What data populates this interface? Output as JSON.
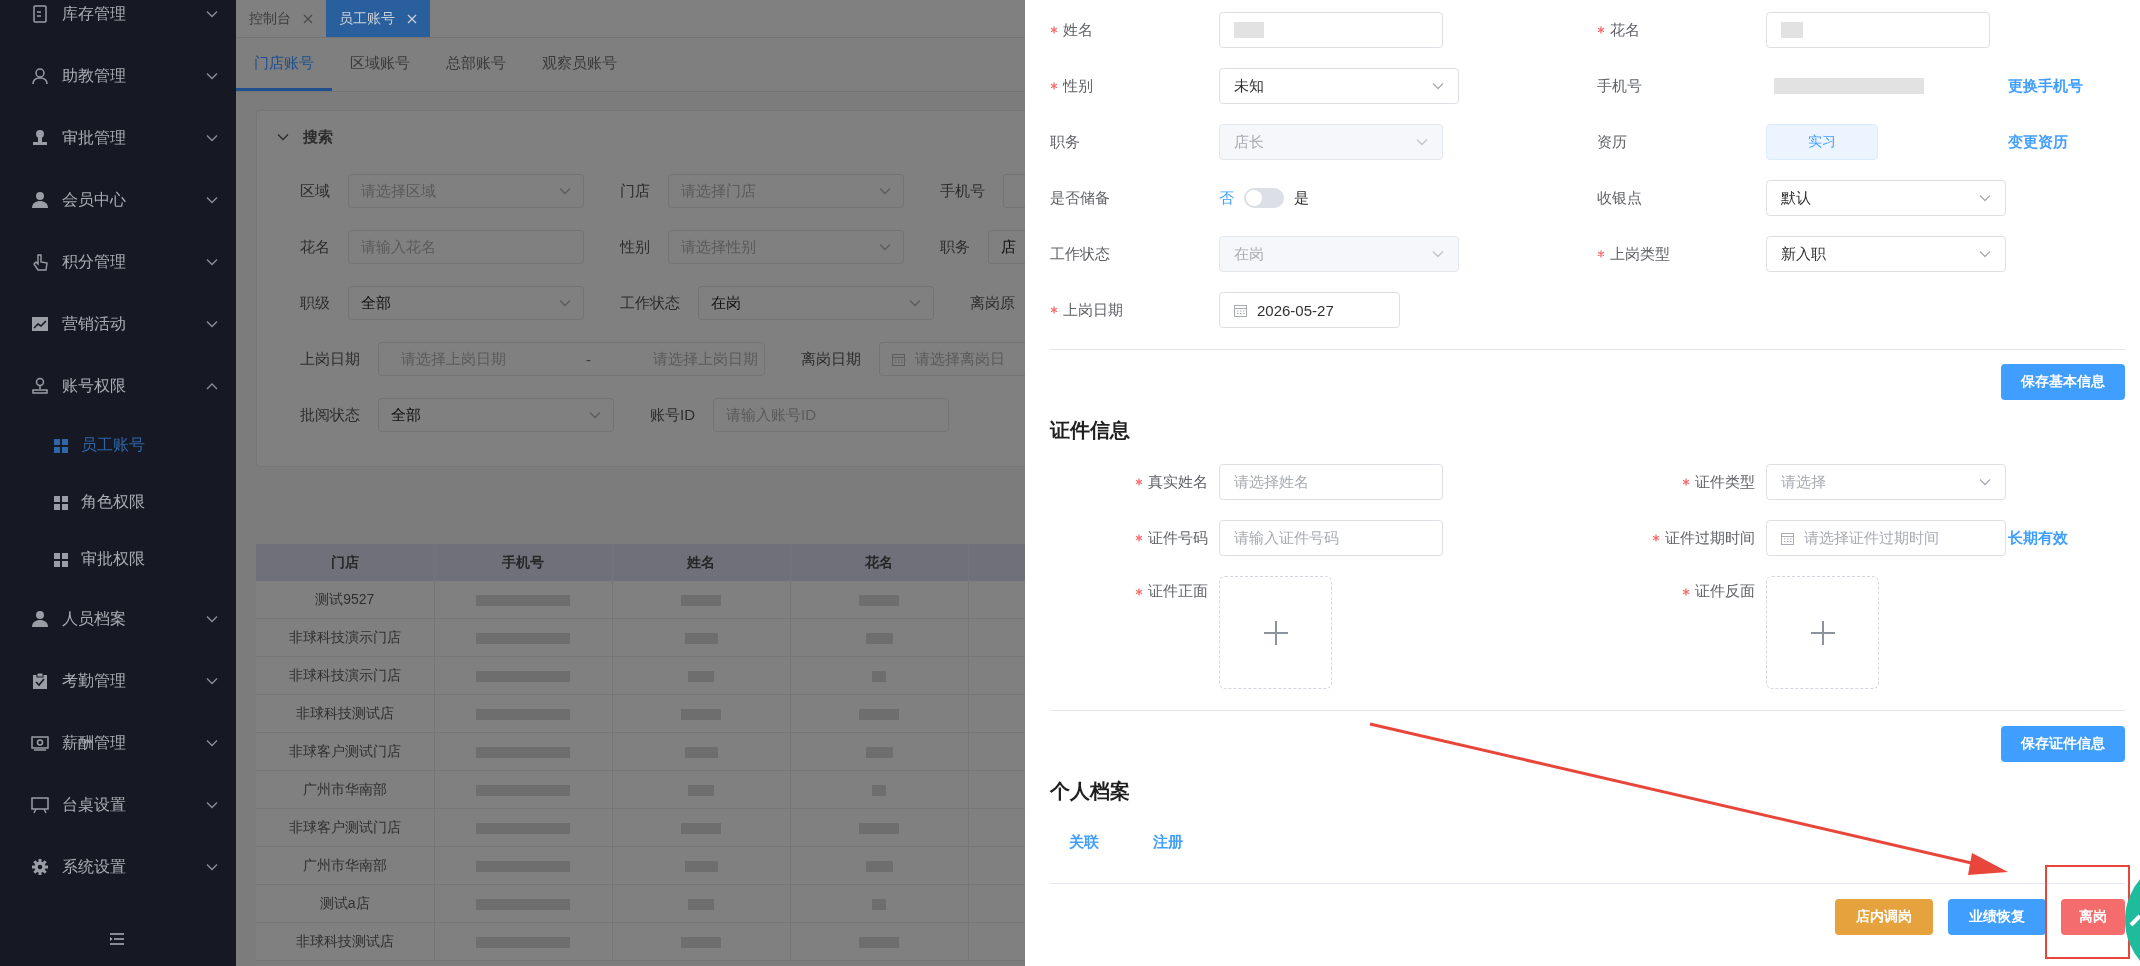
{
  "sidebar": {
    "items": [
      {
        "label": "库存管理",
        "expanded": false
      },
      {
        "label": "助教管理",
        "expanded": false
      },
      {
        "label": "审批管理",
        "expanded": false
      },
      {
        "label": "会员中心",
        "expanded": false
      },
      {
        "label": "积分管理",
        "expanded": false
      },
      {
        "label": "营销活动",
        "expanded": false
      },
      {
        "label": "账号权限",
        "expanded": true,
        "children": [
          {
            "label": "员工账号",
            "selected": true
          },
          {
            "label": "角色权限",
            "selected": false
          },
          {
            "label": "审批权限",
            "selected": false
          }
        ]
      },
      {
        "label": "人员档案",
        "expanded": false
      },
      {
        "label": "考勤管理",
        "expanded": false
      },
      {
        "label": "薪酬管理",
        "expanded": false
      },
      {
        "label": "台桌设置",
        "expanded": false
      },
      {
        "label": "系统设置",
        "expanded": false
      }
    ]
  },
  "tags": [
    {
      "label": "控制台",
      "selected": false
    },
    {
      "label": "员工账号",
      "selected": true
    }
  ],
  "tabs": [
    {
      "label": "门店账号",
      "selected": true
    },
    {
      "label": "区域账号",
      "selected": false
    },
    {
      "label": "总部账号",
      "selected": false
    },
    {
      "label": "观察员账号",
      "selected": false
    }
  ],
  "search_panel": {
    "title": "搜索",
    "expanded": true,
    "fields": [
      {
        "label": "区域",
        "kind": "select",
        "placeholder": "请选择区域"
      },
      {
        "label": "门店",
        "kind": "select",
        "placeholder": "请选择门店"
      },
      {
        "label": "手机号",
        "kind": "input"
      },
      {
        "label": "花名",
        "kind": "input",
        "placeholder": "请输入花名"
      },
      {
        "label": "性别",
        "kind": "select",
        "placeholder": "请选择性别"
      },
      {
        "label": "职务",
        "kind": "input",
        "value": "店"
      },
      {
        "label": "职级",
        "kind": "select",
        "value": "全部"
      },
      {
        "label": "工作状态",
        "kind": "select",
        "value": "在岗"
      },
      {
        "label": "离岗原",
        "kind": "label"
      },
      {
        "label": "上岗日期",
        "kind": "daterange",
        "start_placeholder": "请选择上岗日期",
        "separator": "-",
        "end_placeholder": "请选择上岗日期"
      },
      {
        "label": "离岗日期",
        "kind": "date",
        "placeholder": "请选择离岗日"
      },
      {
        "label": "批阅状态",
        "kind": "select",
        "value": "全部"
      },
      {
        "label": "账号ID",
        "kind": "input",
        "placeholder": "请输入账号ID"
      }
    ]
  },
  "table": {
    "columns": [
      "门店",
      "手机号",
      "姓名",
      "花名"
    ],
    "rows": [
      {
        "store": "测试9527"
      },
      {
        "store": "非球科技演示门店"
      },
      {
        "store": "非球科技演示门店"
      },
      {
        "store": "非球科技测试店"
      },
      {
        "store": "非球客户测试门店"
      },
      {
        "store": "广州市华南部"
      },
      {
        "store": "非球客户测试门店"
      },
      {
        "store": "广州市华南部"
      },
      {
        "store": "测试a店"
      },
      {
        "store": "非球科技测试店"
      }
    ]
  },
  "drawer": {
    "basic_fields": [
      {
        "label": "姓名",
        "required": true,
        "kind": "redacted_input"
      },
      {
        "label": "花名",
        "required": true,
        "kind": "redacted_input"
      },
      {
        "label": "性别",
        "required": true,
        "kind": "select",
        "value": "未知",
        "disabled": false
      },
      {
        "label": "手机号",
        "required": false,
        "kind": "redacted",
        "link": "更换手机号"
      },
      {
        "label": "职务",
        "required": false,
        "kind": "select",
        "value": "店长",
        "disabled": true
      },
      {
        "label": "资历",
        "required": false,
        "kind": "tag",
        "value": "实习",
        "link": "变更资历"
      },
      {
        "label": "是否储备",
        "required": false,
        "kind": "switch",
        "off_label": "否",
        "on_label": "是",
        "on": false
      },
      {
        "label": "收银点",
        "required": false,
        "kind": "select",
        "value": "默认",
        "disabled": false
      },
      {
        "label": "工作状态",
        "required": false,
        "kind": "select",
        "value": "在岗",
        "disabled": true
      },
      {
        "label": "上岗类型",
        "required": true,
        "kind": "select",
        "value": "新入职",
        "disabled": false
      },
      {
        "label": "上岗日期",
        "required": true,
        "kind": "date",
        "value": "2026-05-27"
      }
    ],
    "save_basic": "保存基本信息",
    "id_section": {
      "title": "证件信息",
      "fields": [
        {
          "label": "真实姓名",
          "required": true,
          "kind": "input",
          "placeholder": "请选择姓名"
        },
        {
          "label": "证件类型",
          "required": true,
          "kind": "select",
          "placeholder": "请选择",
          "disabled": false
        },
        {
          "label": "证件号码",
          "required": true,
          "kind": "input",
          "placeholder": "请输入证件号码"
        },
        {
          "label": "证件过期时间",
          "required": true,
          "kind": "date",
          "placeholder": "请选择证件过期时间",
          "link": "长期有效"
        },
        {
          "label": "证件正面",
          "required": true,
          "kind": "upload"
        },
        {
          "label": "证件反面",
          "required": true,
          "kind": "upload"
        }
      ],
      "save": "保存证件信息"
    },
    "profile_section": {
      "title": "个人档案",
      "links": [
        "关联",
        "注册"
      ]
    },
    "footer_buttons": [
      {
        "label": "店内调岗",
        "kind": "warning"
      },
      {
        "label": "业绩恢复",
        "kind": "primary"
      },
      {
        "label": "离岗",
        "kind": "danger"
      }
    ]
  }
}
